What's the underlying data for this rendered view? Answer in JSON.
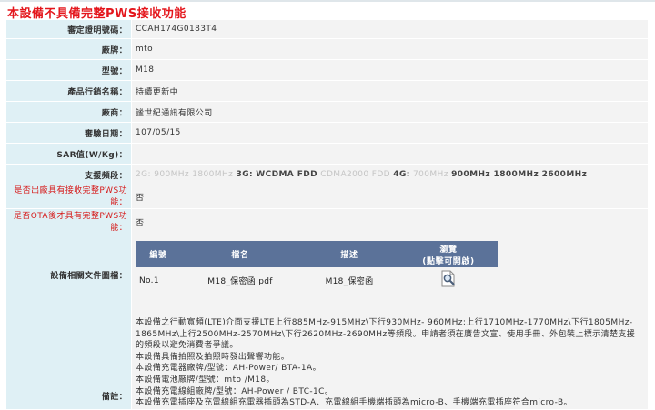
{
  "notice": "本設備不具備完整PWS接收功能",
  "fields": {
    "approval_no": {
      "label": "審定證明號碼：",
      "value": "CCAH174G0183T4"
    },
    "brand": {
      "label": "廠牌：",
      "value": "mto"
    },
    "model": {
      "label": "型號：",
      "value": "M18"
    },
    "marketing_name": {
      "label": "產品行銷名稱：",
      "value": "持續更新中"
    },
    "manufacturer": {
      "label": "廠商：",
      "value": "謐世紀通訊有限公司"
    },
    "approval_date": {
      "label": "審驗日期：",
      "value": "107/05/15"
    },
    "sar": {
      "label": "SAR值(W/Kg)：",
      "value": ""
    },
    "factory_pws": {
      "label": "是否出廠具有接收完整PWS功能：",
      "value": "否"
    },
    "ota_pws": {
      "label": "是否OTA後才具有完整PWS功能：",
      "value": "否"
    }
  },
  "bands": {
    "label": "支援頻段：",
    "g2_label": "2G:",
    "g2_value": "900MHz 1800MHz",
    "g3_label": "3G:",
    "g3_wcdma": "WCDMA FDD",
    "g3_cdma": "CDMA2000 FDD",
    "g4_label": "4G:",
    "g4_inactive": "700MHz",
    "g4_active": "900MHz 1800MHz 2600MHz"
  },
  "docs": {
    "label": "設備相關文件圖檔：",
    "headers": {
      "id": "編號",
      "name": "檔名",
      "desc": "描述",
      "view": "瀏覽",
      "view_sub": "(點擊可開啟)"
    },
    "rows": [
      {
        "id": "No.1",
        "name": "M18_保密函.pdf",
        "desc": "M18_保密函",
        "icon": "magnifier-document-icon"
      }
    ]
  },
  "remarks": {
    "label": "備註：",
    "main": "本設備之行動寬頻(LTE)介面支援LTE上行885MHz-915MHz\\下行930MHz- 960MHz;上行1710MHz-1770MHz\\下行1805MHz-1865MHz\\上行2500MHz-2570MHz\\下行2620MHz-2690MHz等頻段。申請者須在廣告文宣、使用手冊、外包裝上標示清楚支援的頻段以避免消費者爭議。",
    "lines": [
      "本設備具備拍照及拍照時發出聲響功能。",
      "本設備充電器廠牌/型號：AH-Power/ BTA-1A。",
      "本設備電池廠牌/型號：mto /M18。",
      "本設備充電線組廠牌/型號：AH-Power / BTC-1C。",
      "本設備充電插座及充電線組充電器插頭為STD-A、充電線組手機端插頭為micro-B、手機端充電插座符合micro-B。"
    ]
  },
  "colors": {
    "label_bg": "#dff0f5",
    "value_bg": "#f3f3f3",
    "notice": "#e4161c",
    "table_header": "#5b7299"
  }
}
